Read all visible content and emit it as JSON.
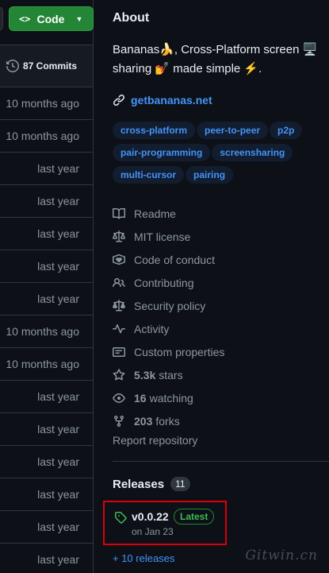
{
  "code_button": {
    "label": "Code",
    "icon": "code-icon"
  },
  "commits": {
    "label": "87 Commits"
  },
  "file_times": [
    "10 months ago",
    "10 months ago",
    "last year",
    "last year",
    "last year",
    "last year",
    "last year",
    "10 months ago",
    "10 months ago",
    "last year",
    "last year",
    "last year",
    "last year",
    "last year",
    "last year"
  ],
  "about": {
    "heading": "About",
    "description": "Bananas🍌, Cross-Platform screen 🖥️ sharing 💅 made simple ⚡.",
    "homepage": "getbananas.net",
    "topics": [
      "cross-platform",
      "peer-to-peer",
      "p2p",
      "pair-programming",
      "screensharing",
      "multi-cursor",
      "pairing"
    ],
    "meta": {
      "readme": "Readme",
      "license": "MIT license",
      "conduct": "Code of conduct",
      "contributing": "Contributing",
      "security": "Security policy",
      "activity": "Activity",
      "custom": "Custom properties",
      "stars_count": "5.3k",
      "stars_label": "stars",
      "watching_count": "16",
      "watching_label": "watching",
      "forks_count": "203",
      "forks_label": "forks"
    },
    "report": "Report repository"
  },
  "releases": {
    "heading": "Releases",
    "count": "11",
    "version": "v0.0.22",
    "latest_badge": "Latest",
    "date": "on Jan 23",
    "more": "+ 10 releases"
  },
  "watermark": "Gitwin.cn",
  "colors": {
    "background": "#0d1117",
    "accent_link": "#4493f8",
    "code_button": "#238636",
    "latest_badge": "#3fb950",
    "highlight_box": "#d9000c"
  }
}
